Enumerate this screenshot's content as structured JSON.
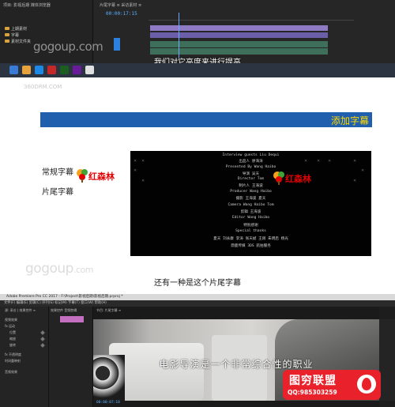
{
  "top_app": {
    "project_tabs": "项目: 影视后期   媒体浏览器",
    "bins": [
      "上期素材",
      "字幕",
      "素材文件夹"
    ],
    "sequence_tabs": "片尾字幕 ≡    采访素材 ≡",
    "timecode": "00:00:17:15",
    "subtitle": "我们对它亮度来进行提高",
    "logo": "gogoup.com"
  },
  "slide": {
    "watermark": "360DRM.COM",
    "banner_title": "添加字幕",
    "label_regular": "常规字幕",
    "label_ending": "片尾字幕",
    "brand_logo": "红森林",
    "credits": [
      "Interview guests Liu Dequi",
      "出品人 廖海涛",
      "Presented By Wang Haibo",
      "导演 吴天",
      "Director Tom",
      "制片人 王海波",
      "Producer Wang Haibo",
      "摄影 王海波 夏天",
      "Camera  Wang Haibo Tom",
      "剪辑 王海波",
      "Editor Wang Haibo",
      "特别感谢",
      "Special thanks",
      "夏天 刘永康 李涛 张天斌 王刚 朱明启 杨光",
      "鼎鹿传媒 3DS 航拍服务"
    ],
    "watermark_logo": "gogoup",
    "watermark_logo_suffix": ".com",
    "subtitle": "还有一种是这个片尾字幕"
  },
  "bottom_app": {
    "title_bar": "Adobe Premiere Pro CC 2017 - F:\\Project\\影视后期\\影视后期.prproj *",
    "menu": "文件(F)  编辑(E)  剪辑(C)  序列(S)  标记(M)  字幕(T)  窗口(W)  帮助(H)",
    "effect_rows": [
      "源: 采访 | 效果控件 ≡",
      "视频效果",
      "fx 运动",
      "位置",
      "缩放",
      "旋转",
      "fx 不透明度",
      "时间重映射",
      "音频效果"
    ],
    "mid_tabs": "效果控件  音频剪辑",
    "program_tabs": "节目: 片尾字幕 ≡",
    "video_subtitle": "电影导演是一个非常综合性的职业",
    "timecode": "00:00:07:18"
  },
  "badge": {
    "title": "图穷联盟",
    "qq": "QQ:985303259"
  },
  "colors": {
    "banner_bg": "#1f5fad",
    "banner_text": "#ffd800",
    "brand_red": "#e30000",
    "badge_red": "#e8212a",
    "timecode_blue": "#5db0ff"
  }
}
